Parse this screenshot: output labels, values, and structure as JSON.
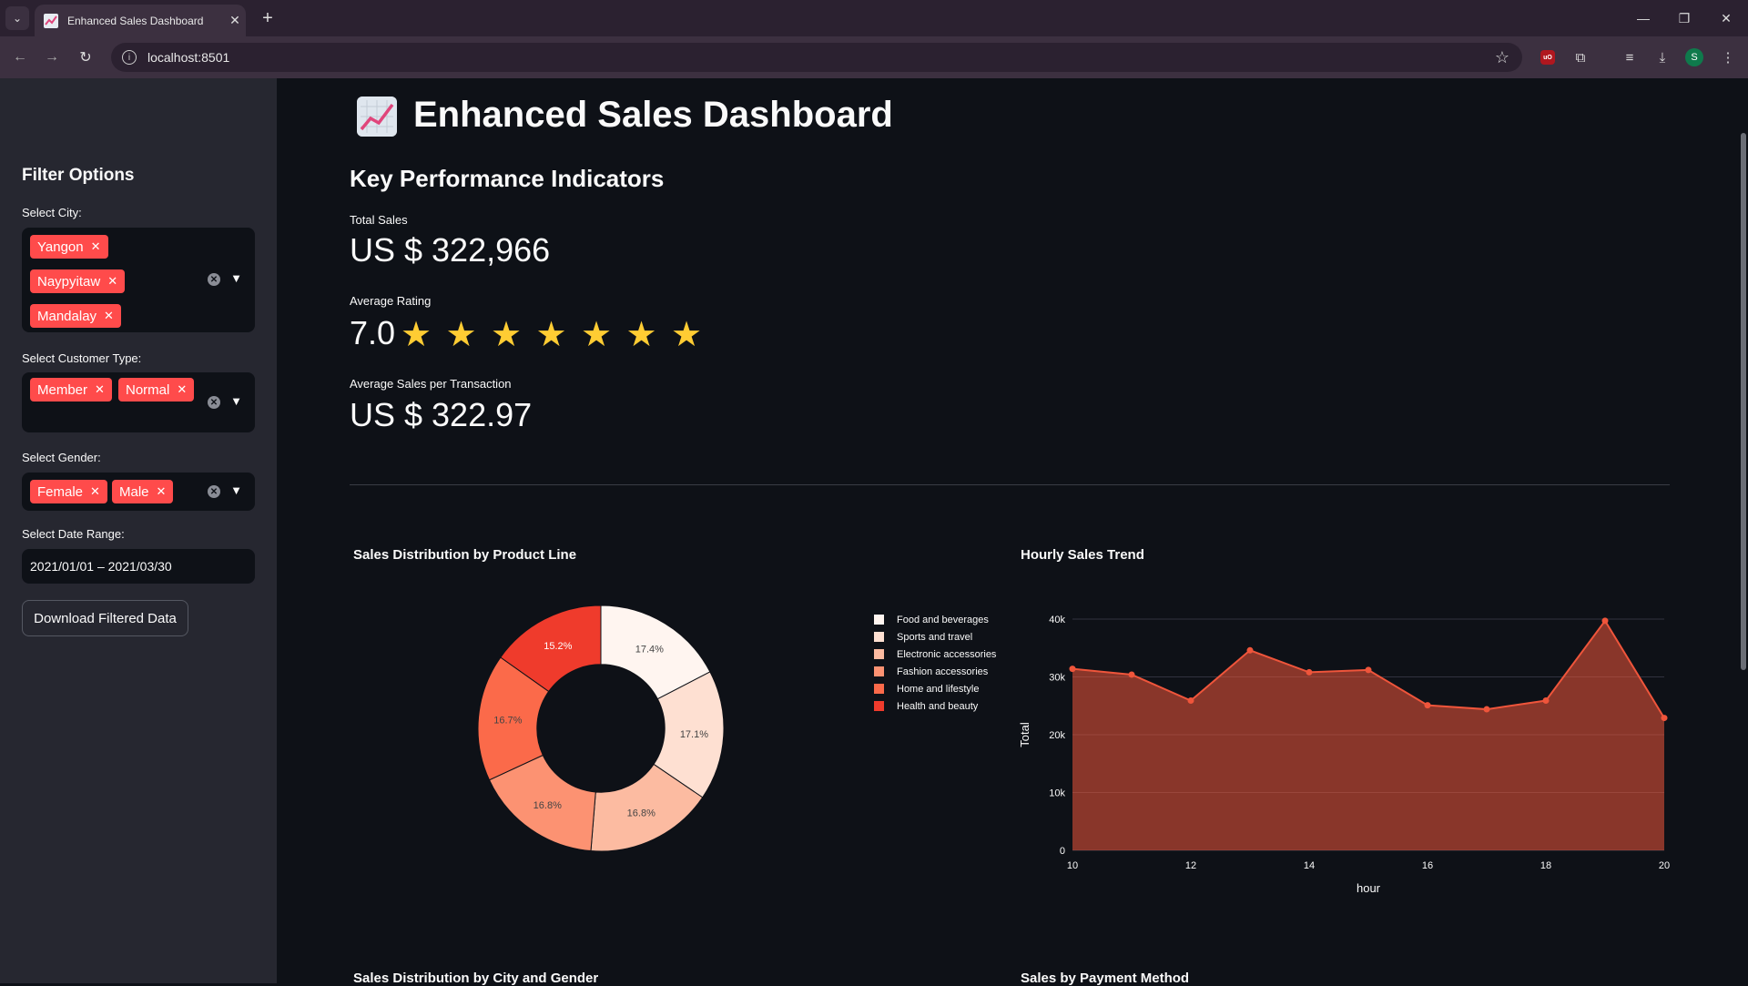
{
  "browser": {
    "tab_title": "Enhanced Sales Dashboard",
    "url": "localhost:8501",
    "profile_initial": "S",
    "ublock_label": "uO"
  },
  "sidebar": {
    "title": "Filter Options",
    "city": {
      "label": "Select City:",
      "chips": [
        "Yangon",
        "Naypyitaw",
        "Mandalay"
      ]
    },
    "customer_type": {
      "label": "Select Customer Type:",
      "chips": [
        "Member",
        "Normal"
      ]
    },
    "gender": {
      "label": "Select Gender:",
      "chips": [
        "Female",
        "Male"
      ]
    },
    "date_range": {
      "label": "Select Date Range:",
      "value": "2021/01/01 – 2021/03/30"
    },
    "download_label": "Download Filtered Data"
  },
  "main": {
    "title": "Enhanced Sales Dashboard",
    "kpi_header": "Key Performance Indicators",
    "total_sales": {
      "label": "Total Sales",
      "value": "US $ 322,966"
    },
    "avg_rating": {
      "label": "Average Rating",
      "value": "7.0",
      "stars": 7
    },
    "avg_sales_tx": {
      "label": "Average Sales per Transaction",
      "value": "US $ 322.97"
    },
    "bottom_left_title": "Sales Distribution by City and Gender",
    "bottom_right_title": "Sales by Payment Method"
  },
  "chart_data": [
    {
      "type": "pie",
      "title": "Sales Distribution by Product Line",
      "categories": [
        "Food and beverages",
        "Sports and travel",
        "Electronic accessories",
        "Fashion accessories",
        "Home and lifestyle",
        "Health and beauty"
      ],
      "values": [
        17.4,
        17.1,
        16.8,
        16.8,
        16.7,
        15.2
      ],
      "labels": [
        "17.4%",
        "17.1%",
        "16.8%",
        "16.8%",
        "16.7%",
        "15.2%"
      ],
      "colors": [
        "#fff5f0",
        "#fee0d2",
        "#fcbba1",
        "#fc9272",
        "#fb6a4a",
        "#ef3b2c"
      ],
      "hole": 0.4,
      "legend": "right"
    },
    {
      "type": "area",
      "title": "Hourly Sales Trend",
      "xlabel": "hour",
      "ylabel": "Total",
      "x": [
        10,
        11,
        12,
        13,
        14,
        15,
        16,
        17,
        18,
        19,
        20
      ],
      "y": [
        31400,
        30400,
        25900,
        34600,
        30800,
        31200,
        25100,
        24400,
        25900,
        39700,
        22900
      ],
      "xticks": [
        "10",
        "12",
        "14",
        "16",
        "18",
        "20"
      ],
      "yticks": [
        "0",
        "10k",
        "20k",
        "30k",
        "40k"
      ],
      "xlim": [
        10,
        20
      ],
      "ylim": [
        0,
        40000
      ],
      "color": "#ef553b",
      "grid": true
    }
  ]
}
